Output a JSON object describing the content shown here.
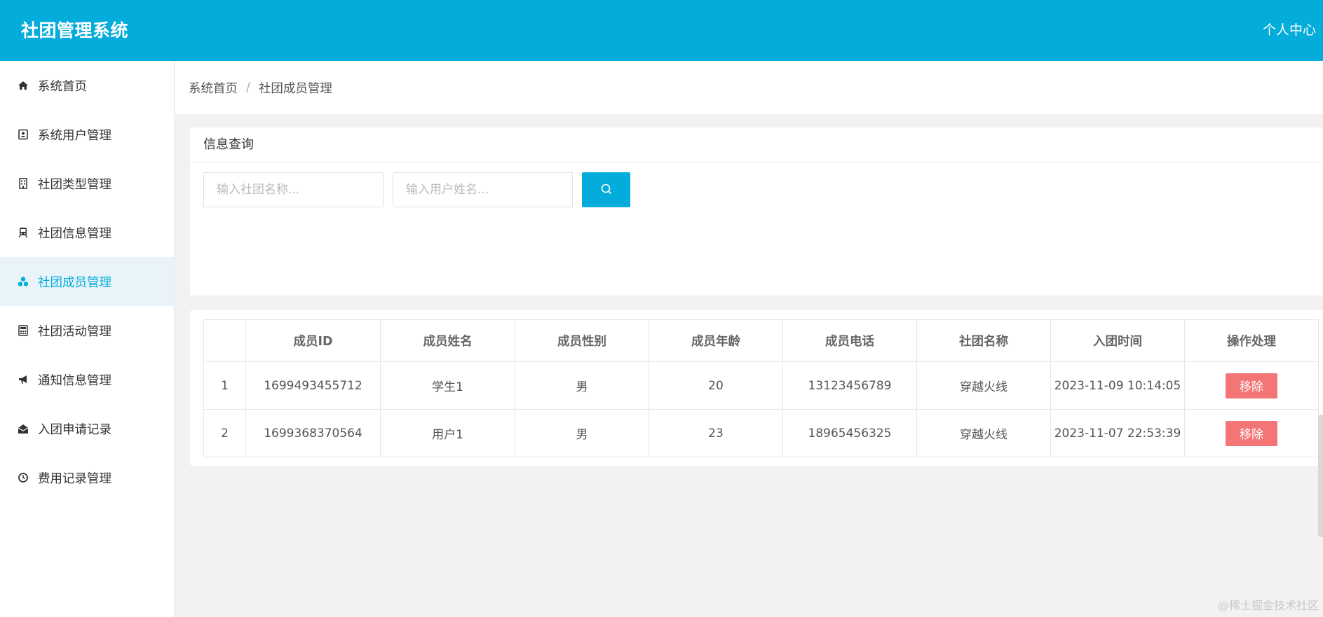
{
  "header": {
    "title": "社团管理系统",
    "user_center": "个人中心"
  },
  "sidebar": {
    "items": [
      {
        "label": "系统首页",
        "icon": "home-icon"
      },
      {
        "label": "系统用户管理",
        "icon": "contact-card-icon"
      },
      {
        "label": "社团类型管理",
        "icon": "building-icon"
      },
      {
        "label": "社团信息管理",
        "icon": "train-icon"
      },
      {
        "label": "社团成员管理",
        "icon": "cubes-icon",
        "active": true
      },
      {
        "label": "社团活动管理",
        "icon": "calculator-icon"
      },
      {
        "label": "通知信息管理",
        "icon": "bullhorn-icon"
      },
      {
        "label": "入团申请记录",
        "icon": "envelope-open-icon"
      },
      {
        "label": "费用记录管理",
        "icon": "clock-icon"
      }
    ]
  },
  "breadcrumb": {
    "home": "系统首页",
    "separator": "/",
    "current": "社团成员管理"
  },
  "query": {
    "title": "信息查询",
    "club_placeholder": "输入社团名称...",
    "user_placeholder": "输入用户姓名...",
    "search_icon": "search-icon"
  },
  "table": {
    "headers": [
      "",
      "成员ID",
      "成员姓名",
      "成员性别",
      "成员年龄",
      "成员电话",
      "社团名称",
      "入团时间",
      "操作处理"
    ],
    "rows": [
      {
        "index": "1",
        "id": "1699493455712",
        "name": "学生1",
        "gender": "男",
        "age": "20",
        "phone": "13123456789",
        "club": "穿越火线",
        "join_time": "2023-11-09 10:14:05",
        "action": "移除"
      },
      {
        "index": "2",
        "id": "1699368370564",
        "name": "用户1",
        "gender": "男",
        "age": "23",
        "phone": "18965456325",
        "club": "穿越火线",
        "join_time": "2023-11-07 22:53:39",
        "action": "移除"
      }
    ]
  },
  "watermark": "@稀土掘金技术社区",
  "colors": {
    "primary": "#03acda",
    "danger": "#f37575",
    "active_bg": "#e8f4fa"
  }
}
